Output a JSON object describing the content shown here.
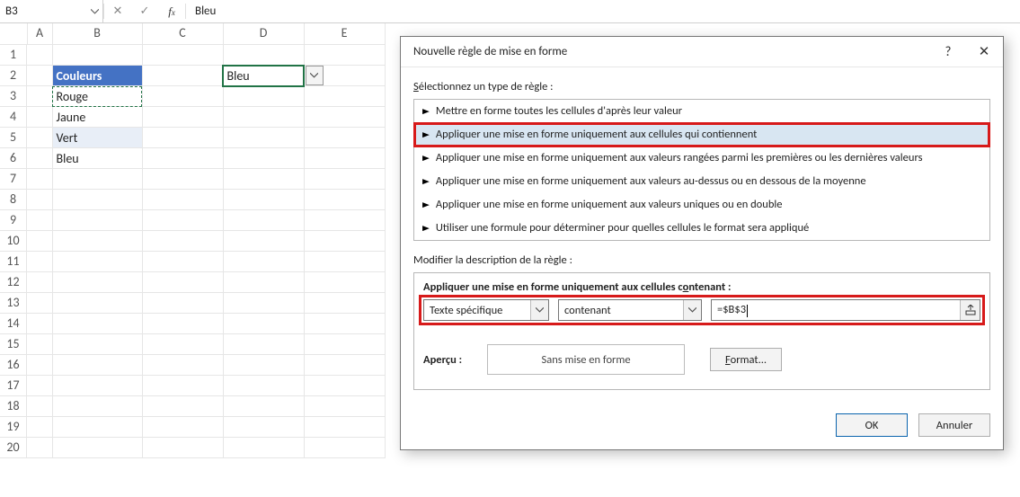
{
  "name_box": "B3",
  "formula_value": "Bleu",
  "columns": [
    "A",
    "B",
    "C",
    "D",
    "E"
  ],
  "rows": [
    "1",
    "2",
    "3",
    "4",
    "5",
    "6",
    "7",
    "8",
    "9",
    "10",
    "11",
    "12",
    "13",
    "14",
    "15",
    "16",
    "17",
    "18",
    "19",
    "20"
  ],
  "cells": {
    "B2": "Couleurs",
    "B3": "Rouge",
    "B4": "Jaune",
    "B5": "Vert",
    "B6": "Bleu",
    "D2": "Bleu"
  },
  "dialog": {
    "title": "Nouvelle règle de mise en forme",
    "help": "?",
    "section_select": "Sélectionnez un type de règle :",
    "rules": [
      "Mettre en forme toutes les cellules d'après leur valeur",
      "Appliquer une mise en forme uniquement aux cellules qui contiennent",
      "Appliquer une mise en forme uniquement aux valeurs rangées parmi les premières ou les dernières valeurs",
      "Appliquer une mise en forme uniquement aux valeurs au-dessus ou en dessous de la moyenne",
      "Appliquer une mise en forme uniquement aux valeurs uniques ou en double",
      "Utiliser une formule pour déterminer pour quelles cellules le format sera appliqué"
    ],
    "section_modify_pre": "M",
    "section_modify_rest": "odifier la description de la règle :",
    "sub_pre": "Appliquer une mise en forme uniquement aux cellules c",
    "sub_ul": "o",
    "sub_post": "ntenant :",
    "combo1": "Texte spécifique",
    "combo2": "contenant",
    "ref": "=$B$3",
    "preview_label": "Aperçu :",
    "preview_value": "Sans mise en forme",
    "format_btn_pre": "F",
    "format_btn_rest": "ormat...",
    "ok": "OK",
    "cancel": "Annuler"
  }
}
